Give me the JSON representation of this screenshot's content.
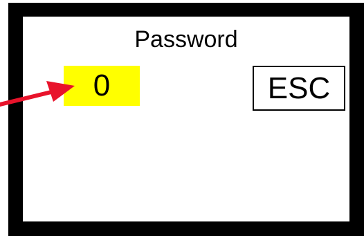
{
  "screen": {
    "title": "Password",
    "value": "0",
    "esc_label": "ESC"
  },
  "colors": {
    "frame": "#000000",
    "value_highlight": "#ffff00",
    "pointer_arrow": "#e8132b"
  },
  "icons": {
    "pointer": "red-arrow-icon"
  }
}
